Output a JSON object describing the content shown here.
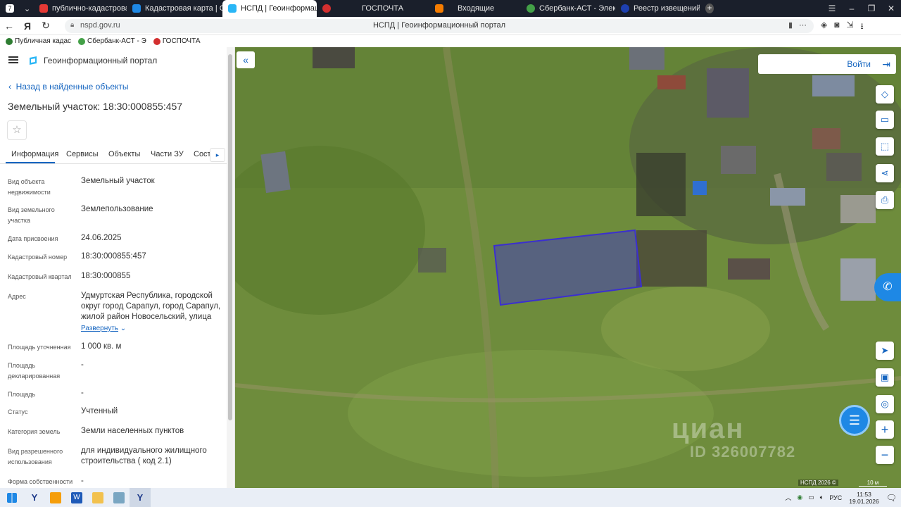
{
  "browser": {
    "tabs": [
      {
        "label": "публично-кадастровая к",
        "color": "#e53935"
      },
      {
        "label": "Кадастровая карта | Сер",
        "color": "#1e88e5"
      },
      {
        "label": "НСПД | Геоинформаци",
        "color": "#29b6f6",
        "active": true
      },
      {
        "label": "",
        "color": "#d32f2f"
      },
      {
        "label": "ГОСПОЧТА",
        "color": ""
      },
      {
        "label": "Входящие",
        "color": "#f57c00"
      },
      {
        "label": "Сбербанк-АСТ - Электро",
        "color": "#43a047"
      },
      {
        "label": "Реестр извещений",
        "color": "#1e40af"
      }
    ],
    "url_host": "nspd.gov.ru",
    "page_title": "НСПД | Геоинформационный портал",
    "bookmarks": [
      {
        "label": "Публичная кадас",
        "color": "#2e7d32"
      },
      {
        "label": "Сбербанк-АСТ - Э",
        "color": "#43a047"
      },
      {
        "label": "ГОСПОЧТА",
        "color": "#d32f2f"
      }
    ]
  },
  "sidebar": {
    "portal_name": "Геоинформационный портал",
    "back_label": "Назад в найденные объекты",
    "title": "Земельный участок: 18:30:000855:457",
    "tabs": [
      "Информация",
      "Сервисы",
      "Объекты",
      "Части ЗУ",
      "Соста"
    ],
    "rows": [
      {
        "label": "Вид объекта недвижимости",
        "value": "Земельный участок"
      },
      {
        "label": "Вид земельного участка",
        "value": "Землепользование"
      },
      {
        "label": "Дата присвоения",
        "value": "24.06.2025"
      },
      {
        "label": "Кадастровый номер",
        "value": "18:30:000855:457"
      },
      {
        "label": "Кадастровый квартал",
        "value": "18:30:000855"
      },
      {
        "label": "Адрес",
        "value": "Удмуртская Республика, городской округ город Сарапул, город Сарапул, жилой район Новосельский, улица"
      },
      {
        "label": "Площадь уточненная",
        "value": "1 000 кв. м"
      },
      {
        "label": "Площадь декларированная",
        "value": "-"
      },
      {
        "label": "Площадь",
        "value": "-"
      },
      {
        "label": "Статус",
        "value": "Учтенный"
      },
      {
        "label": "Категория земель",
        "value": "Земли населенных пунктов"
      },
      {
        "label": "Вид разрешенного использования",
        "value": "для индивидуального жилищного строительства ( код 2.1)"
      },
      {
        "label": "Форма собственности",
        "value": "-"
      }
    ],
    "expand_label": "Развернуть"
  },
  "map": {
    "login_label": "Войти",
    "watermark_brand": "циан",
    "watermark_id": "ID 326007782",
    "copyright": "НСПД 2026 ©",
    "scale_label": "10 м",
    "parcel_color": "#3b2fd0"
  },
  "taskbar": {
    "lang": "РУС",
    "time": "11:53",
    "date": "19.01.2026"
  }
}
